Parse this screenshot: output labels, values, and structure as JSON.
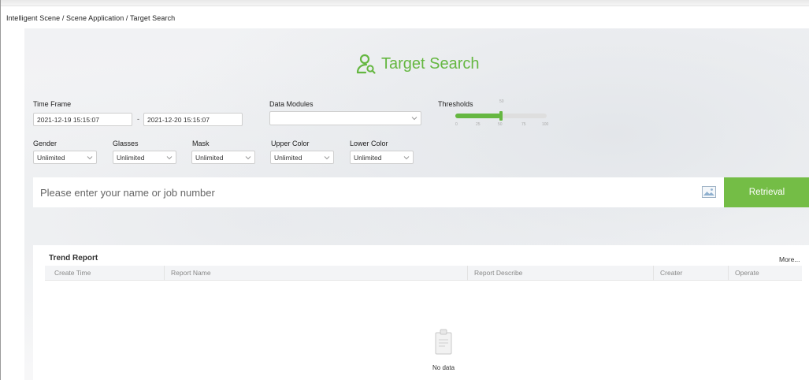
{
  "breadcrumb": "Intelligent Scene / Scene Application / Target Search",
  "page_title": "Target Search",
  "filters": {
    "time_frame_label": "Time Frame",
    "time_start": "2021-12-19 15:15:07",
    "time_sep": "-",
    "time_end": "2021-12-20 15:15:07",
    "data_modules_label": "Data Modules",
    "data_modules_value": "",
    "thresholds_label": "Thresholds",
    "threshold_value": "50",
    "threshold_ticks": [
      "0",
      "25",
      "50",
      "75",
      "100"
    ],
    "threshold_fraction": 0.5,
    "gender_label": "Gender",
    "gender_value": "Unlimited",
    "glasses_label": "Glasses",
    "glasses_value": "Unlimited",
    "mask_label": "Mask",
    "mask_value": "Unlimited",
    "upper_color_label": "Upper Color",
    "upper_color_value": "Unlimited",
    "lower_color_label": "Lower Color",
    "lower_color_value": "Unlimited"
  },
  "search": {
    "placeholder": "Please enter your name or job number",
    "button_label": "Retrieval"
  },
  "report": {
    "title": "Trend Report",
    "more_label": "More...",
    "columns": [
      "Create Time",
      "Report Name",
      "Report Describe",
      "Creater",
      "Operate"
    ],
    "empty_text": "No data"
  },
  "colors": {
    "accent": "#65b741",
    "button": "#74bd46"
  },
  "icons": {
    "title": "user-search-icon",
    "image_search": "image-icon",
    "empty": "clipboard-icon",
    "dropdown": "chevron-down-icon"
  }
}
